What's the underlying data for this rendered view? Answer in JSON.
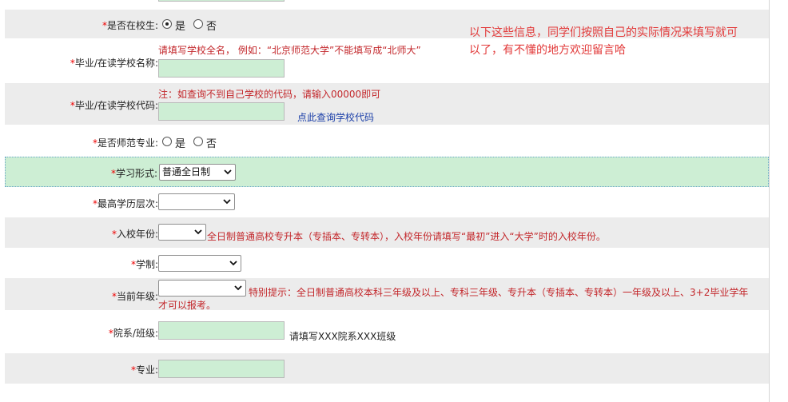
{
  "overlay_note": {
    "line1": "以下这些信息，同学们按照自己的实际情况来填写就可",
    "line2": "以了，有不懂的地方欢迎留言哈"
  },
  "fields": {
    "in_school": {
      "label": "是否在校生:",
      "options": [
        "是",
        "否"
      ],
      "selected": "是"
    },
    "school_name": {
      "label": "毕业/在读学校名称:",
      "hint": "请填写学校全名， 例如：“北京师范大学”不能填写成“北师大”",
      "value": ""
    },
    "school_code": {
      "label": "毕业/在读学校代码:",
      "hint": "注：如查询不到自己学校的代码，请输入00000即可",
      "link": "点此查询学校代码",
      "value": ""
    },
    "is_normal_major": {
      "label": "是否师范专业:",
      "options": [
        "是",
        "否"
      ],
      "selected": ""
    },
    "study_form": {
      "label": "学习形式:",
      "value": "普通全日制"
    },
    "highest_edu": {
      "label": "最高学历层次:",
      "value": ""
    },
    "enroll_year": {
      "label": "入校年份:",
      "value": "",
      "hint": "全日制普通高校专升本（专插本、专转本），入校年份请填写“最初”进入“大学”时的入校年份。"
    },
    "schooling": {
      "label": "学制:",
      "value": ""
    },
    "current_grade": {
      "label": "当前年级:",
      "value": "",
      "hint_line1": "特别提示：全日制普通高校本科三年级及以上、专科三年级、专升本（专插本、专转本）一年级及以上、3+2毕业学年",
      "hint_line2": "才可以报考。"
    },
    "department_class": {
      "label": "院系/班级:",
      "value": "",
      "hint": "请填写XXX院系XXX班级"
    },
    "major": {
      "label": "专业:",
      "value": ""
    }
  },
  "required_mark": "*",
  "colors": {
    "required": "#e00000",
    "hint_red": "#c3272b",
    "link_blue": "#1a3ea8",
    "field_green": "#cdeed4",
    "row_gray": "#ececec"
  }
}
